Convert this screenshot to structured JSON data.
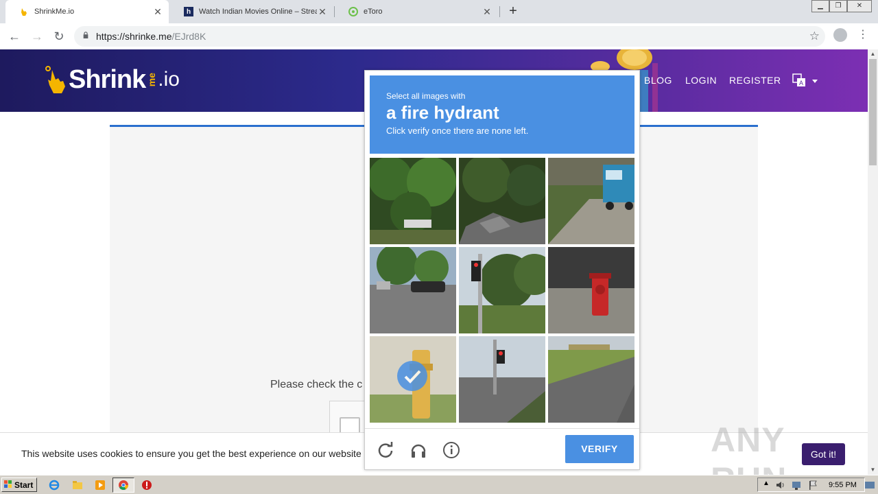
{
  "browser": {
    "tabs": [
      {
        "title": "ShrinkMe.io",
        "active": true
      },
      {
        "title": "Watch Indian Movies Online – Strea",
        "active": false
      },
      {
        "title": "eToro",
        "active": false
      }
    ],
    "url_host": "https://shrinke.me",
    "url_path": "/EJrd8K"
  },
  "site": {
    "logo_brand": "Shrink",
    "logo_me": "me",
    "logo_io": ".io",
    "nav": [
      "BLOG",
      "LOGIN",
      "REGISTER"
    ],
    "instruction": "Please check the c",
    "cookie_text": "This website uses cookies to ensure you get the best experience on our website",
    "cookie_button": "Got it!",
    "watermark": "ANY RUN"
  },
  "captcha": {
    "prompt_small": "Select all images with",
    "prompt_target": "a fire hydrant",
    "prompt_sub": "Click verify once there are none left.",
    "verify_label": "VERIFY",
    "selected_tiles": [
      6
    ],
    "tiles": [
      "trees",
      "debris",
      "truck-street",
      "parking-lot",
      "traffic-light",
      "red-fire-hydrant",
      "yellow-fire-hydrant",
      "intersection",
      "road-curve"
    ]
  },
  "taskbar": {
    "start_label": "Start",
    "clock": "9:55 PM"
  },
  "colors": {
    "captcha_blue": "#4a90e2",
    "hero_start": "#1e1a5e",
    "hero_end": "#7c2fb3",
    "cookie_button": "#3a1e6e"
  }
}
